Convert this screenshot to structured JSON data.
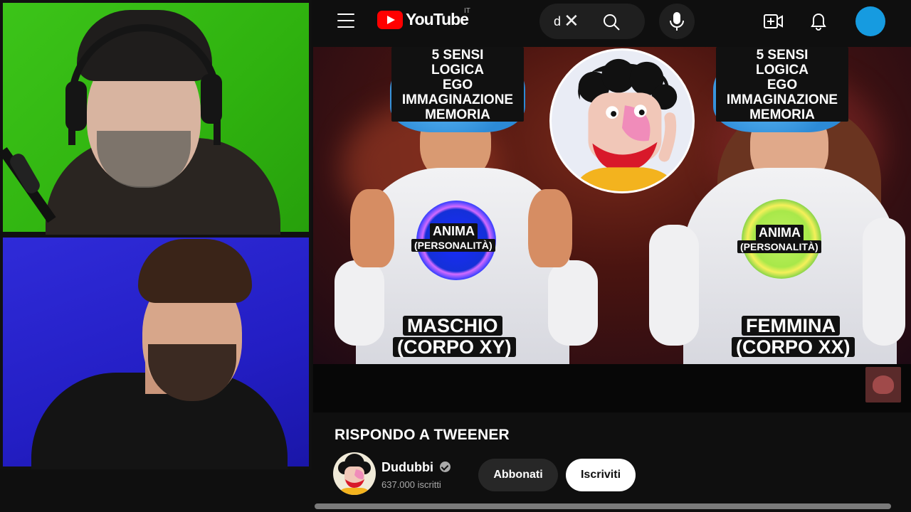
{
  "app": {
    "logo_text": "YouTube",
    "country_code": "IT"
  },
  "search": {
    "value": "d"
  },
  "icons": {
    "menu": "hamburger-menu-icon",
    "clear": "close-icon",
    "search": "search-icon",
    "mic": "microphone-icon",
    "create": "create-video-icon",
    "notifications": "bell-icon",
    "account": "account-avatar"
  },
  "thumbnail": {
    "left_brain": [
      "5 SENSI",
      "LOGICA",
      "EGO",
      "IMMAGINAZIONE",
      "MEMORIA"
    ],
    "right_brain": [
      "5 SENSI",
      "LOGICA",
      "EGO",
      "IMMAGINAZIONE",
      "MEMORIA"
    ],
    "soul_title": "ANIMA",
    "soul_subtitle": "(PERSONALITÀ)",
    "male_line1": "MASCHIO",
    "male_line2": "(CORPO XY)",
    "female_line1": "FEMMINA",
    "female_line2": "(CORPO XX)"
  },
  "video": {
    "title": "RISPONDO A TWEENER"
  },
  "channel": {
    "name": "Dudubbi",
    "subscribers": "637.000 iscritti",
    "join_label": "Abbonati",
    "subscribe_label": "Iscriviti"
  },
  "colors": {
    "youtube_red": "#ff0000",
    "green_screen": "#3cc419",
    "blue_screen": "#2f2bd8",
    "avatar_blue": "#169be0",
    "background": "#0f0f0f"
  }
}
